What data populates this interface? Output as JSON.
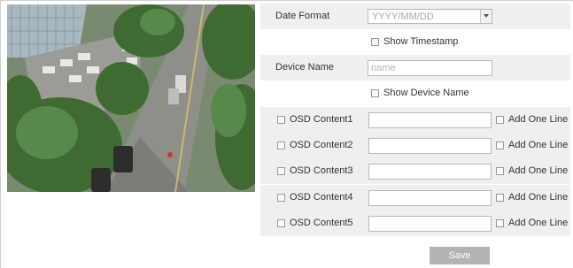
{
  "date_format": {
    "label": "Date Format",
    "value": "YYYY/MM/DD",
    "show_timestamp_label": "Show Timestamp",
    "show_timestamp_checked": false
  },
  "device_name": {
    "label": "Device Name",
    "placeholder": "name",
    "show_device_name_label": "Show Device Name",
    "show_device_name_checked": false
  },
  "osd": [
    {
      "label": "OSD Content1",
      "value": "",
      "add_line_label": "Add One Line"
    },
    {
      "label": "OSD Content2",
      "value": "",
      "add_line_label": "Add One Line"
    },
    {
      "label": "OSD Content3",
      "value": "",
      "add_line_label": "Add One Line"
    },
    {
      "label": "OSD Content4",
      "value": "",
      "add_line_label": "Add One Line"
    },
    {
      "label": "OSD Content5",
      "value": "",
      "add_line_label": "Add One Line"
    }
  ],
  "save_label": "Save",
  "colors": {
    "row_shade": "#efefef",
    "save_button": "#b3b3b3",
    "border": "#b9b9b9"
  }
}
